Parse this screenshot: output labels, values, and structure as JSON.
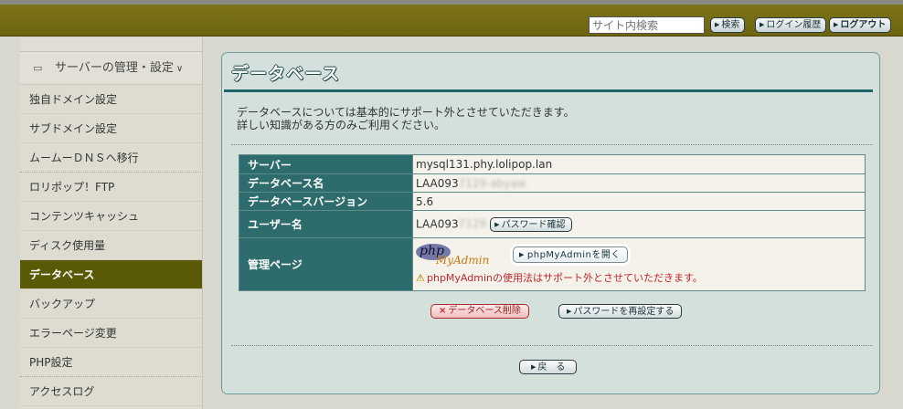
{
  "header": {
    "search_placeholder": "サイト内検索",
    "search_button": "検索",
    "login_history_button": "ログイン履歴",
    "logout_button": "ログアウト"
  },
  "sidebar": {
    "section_title": "サーバーの管理・設定",
    "items": [
      {
        "label": "独自ドメイン設定"
      },
      {
        "label": "サブドメイン設定"
      },
      {
        "label": "ムームーＤＮＳへ移行"
      },
      {
        "label": "ロリポップ！FTP"
      },
      {
        "label": "コンテンツキャッシュ"
      },
      {
        "label": "ディスク使用量"
      },
      {
        "label": "データベース"
      },
      {
        "label": "バックアップ"
      },
      {
        "label": "エラーページ変更"
      },
      {
        "label": "PHP設定"
      },
      {
        "label": "アクセスログ"
      }
    ],
    "active_index": 6
  },
  "main": {
    "title": "データベース",
    "intro_line1": "データベースについては基本的にサポート外とさせていただきます。",
    "intro_line2": "詳しい知識がある方のみご利用ください。",
    "rows": [
      {
        "label": "サーバー",
        "value": "mysql131.phy.lolipop.lan"
      },
      {
        "label": "データベース名",
        "value": "LAA093",
        "masked": "7129-abyaw"
      },
      {
        "label": "データベースバージョン",
        "value": "5.6"
      },
      {
        "label": "ユーザー名",
        "value": "LAA093",
        "masked": "7129",
        "button": "パスワード確認"
      },
      {
        "label": "管理ページ",
        "logo_php": "php",
        "logo_myadmin": "MyAdmin",
        "button": "phpMyAdminを開く",
        "warning": "phpMyAdminの使用法はサポート外とさせていただきます。"
      }
    ],
    "delete_button": "データベース削除",
    "reset_password_button": "パスワードを再設定する",
    "back_button": "戻　る"
  },
  "colors": {
    "header_bg": "#6f6711",
    "active_sidebar": "#5a5a06",
    "table_header": "#2e6b6c",
    "panel_bg": "#d3e0dc",
    "warning_text": "#c0272b"
  }
}
